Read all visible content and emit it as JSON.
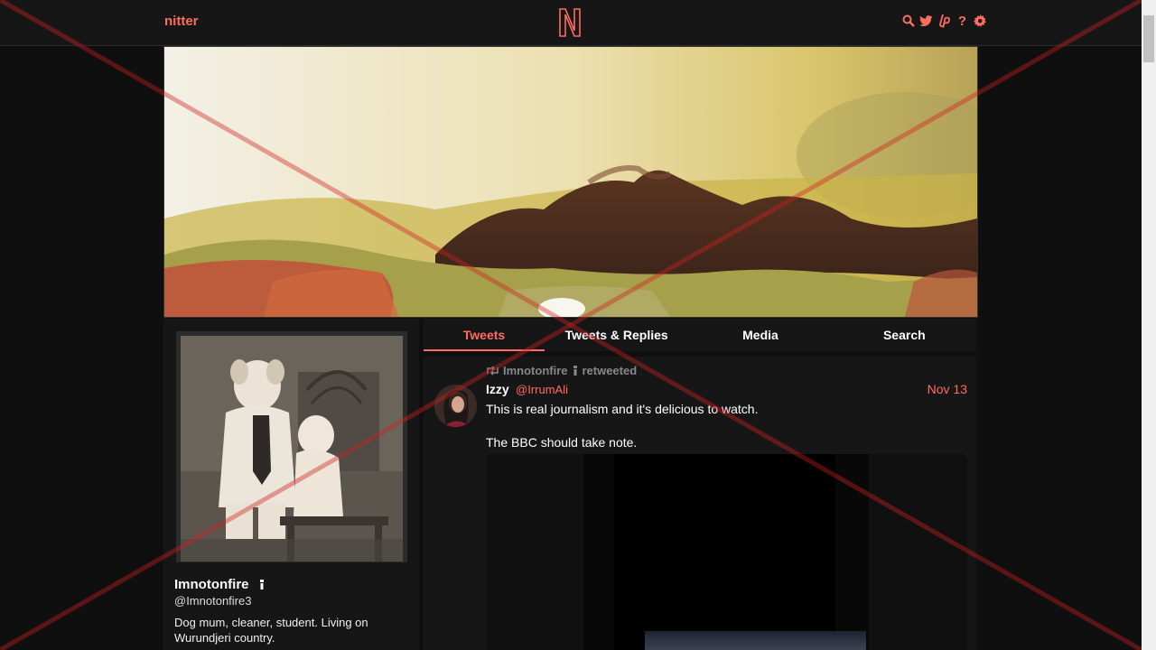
{
  "navbar": {
    "brand": "nitter",
    "logo_letter": "N",
    "icons": [
      "search-icon",
      "twitter-bird-icon",
      "liberapay-icon",
      "help-icon",
      "gear-icon"
    ],
    "help_glyph": "?",
    "accent_color": "#ff6c60"
  },
  "profile": {
    "fullname": "Imnotonfire",
    "handle": "@Imnotonfire3",
    "bio": "Dog mum, cleaner, student. Living on Wurundjeri country."
  },
  "tabs": [
    {
      "label": "Tweets",
      "active": true
    },
    {
      "label": "Tweets & Replies",
      "active": false
    },
    {
      "label": "Media",
      "active": false
    },
    {
      "label": "Search",
      "active": false
    }
  ],
  "tweet": {
    "retweet_user": "Imnotonfire",
    "retweet_label": "retweeted",
    "fullname": "Izzy",
    "username": "@IrrumAli",
    "date": "Nov 13",
    "text_lines": [
      "This is real journalism and it's delicious to watch.",
      "The BBC should take note."
    ]
  },
  "colors": {
    "background": "#0f0f0f",
    "panel": "#161616",
    "accent": "#ff6c60",
    "overlay_x": "#d02020"
  }
}
